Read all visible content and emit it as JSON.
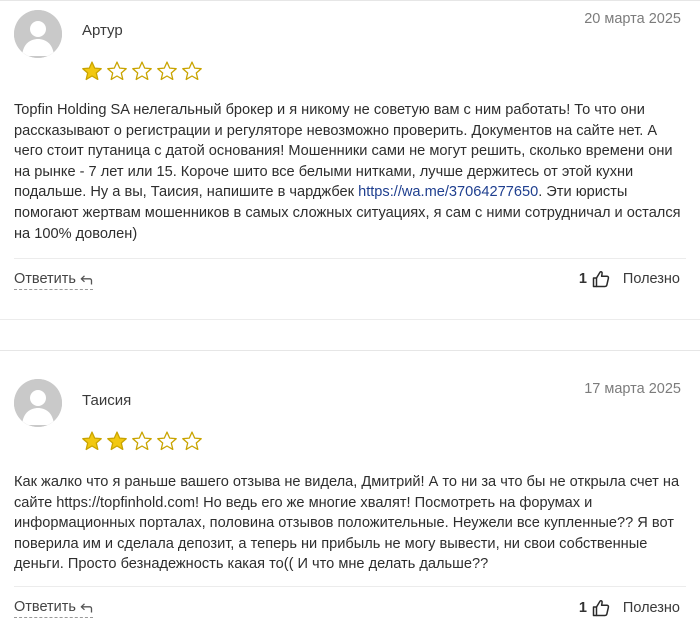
{
  "reviews": [
    {
      "author": "Артур",
      "date": "20 марта 2025",
      "rating": 1,
      "rating_max": 5,
      "text_before_link": "Topfin Holding SA нелегальный брокер и я никому не советую вам с ним работать! То что они рассказывают о регистрации и регуляторе невозможно проверить. Документов на сайте нет. А чего стоит путаница с датой основания! Мошенники сами не могут решить, сколько времени они на рынке - 7 лет или 15. Короче шито все белыми нитками, лучше держитесь от этой кухни подальше. Ну а вы, Таисия, напишите в чарджбек ",
      "link": "https://wa.me/37064277650",
      "text_after_link": ". Эти юристы помогают жертвам мошенников в самых сложных ситуациях, я сам с ними сотрудничал и остался на 100% доволен)",
      "reply_label": "Ответить",
      "likes": "1",
      "useful_label": "Полезно"
    },
    {
      "author": "Таисия",
      "date": "17 марта 2025",
      "rating": 2,
      "rating_max": 5,
      "text_before_link": "Как жалко что я раньше вашего отзыва не видела, Дмитрий! А то ни за что бы не открыла счет на сайте https://topfinhold.com! Но ведь его же многие хвалят! Посмотреть на форумах и информационных порталах, половина отзывов положительные. Неужели все купленные?? Я вот поверила им и сделала депозит, а теперь ни прибыль не могу вывести, ни свои собственные деньги. Просто безнадежность какая то(( И что мне делать дальше??",
      "link": "",
      "text_after_link": "",
      "reply_label": "Ответить",
      "likes": "1",
      "useful_label": "Полезно"
    }
  ],
  "colors": {
    "star_fill": "#f2c811",
    "star_stroke": "#c9a400",
    "link": "#1f3f8f",
    "date": "#7c7c7c",
    "avatar_bg": "#c9c9c9"
  },
  "icons": {
    "avatar": "user-silhouette-icon",
    "star_filled": "star-filled-icon",
    "star_empty": "star-empty-icon",
    "reply": "reply-arrow-icon",
    "like": "thumbs-up-icon"
  }
}
